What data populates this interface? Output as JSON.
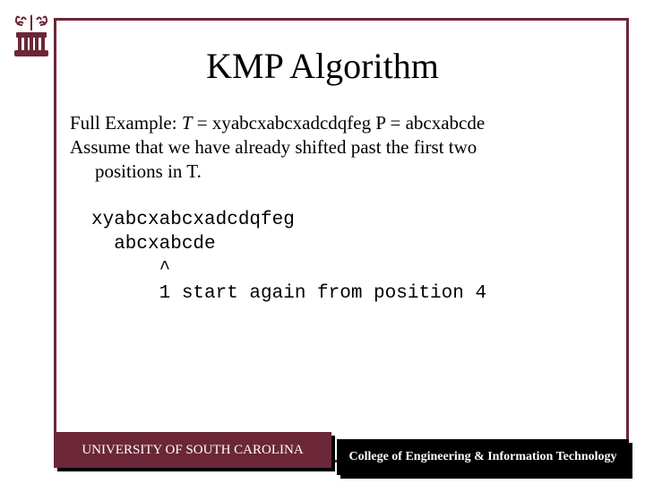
{
  "title": "KMP Algorithm",
  "body": {
    "line1_prefix": "Full Example: ",
    "line1_T_label": "T",
    "line1_T_value": " = xyabcxabcxadcdqfeg P = abcxabcde",
    "line2": "Assume that we have already shifted past the first two",
    "line3": "positions in T."
  },
  "mono": {
    "l1": "xyabcxabcxadcdqfeg",
    "l2": "  abcxabcde",
    "l3": "      ^",
    "l4": "      1 start again from position 4"
  },
  "footer": {
    "left": "UNIVERSITY OF SOUTH CAROLINA",
    "right": "College of Engineering & Information Technology"
  },
  "colors": {
    "garnet": "#6b2737"
  }
}
